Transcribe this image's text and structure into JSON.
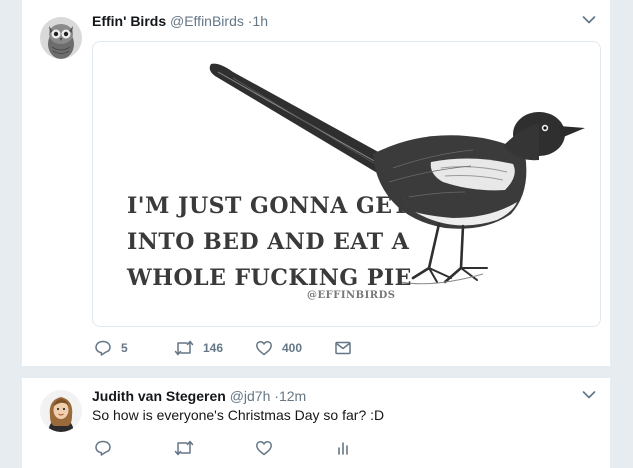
{
  "tweets": [
    {
      "name": "Effin' Birds",
      "handle": "@EffinBirds",
      "time": "·1h",
      "image": {
        "quote_lines": [
          "I'M JUST GONNA GET",
          "INTO BED AND EAT A",
          "WHOLE FUCKING PIE"
        ],
        "watermark": "@EFFINBIRDS"
      },
      "actions": {
        "replies": "5",
        "retweets": "146",
        "likes": "400"
      }
    },
    {
      "name": "Judith van Stegeren",
      "handle": "@jd7h",
      "time": "·12m",
      "text": "So how is everyone's Christmas Day so far? :D"
    }
  ],
  "colors": {
    "background": "#e6ecf0",
    "card": "#ffffff",
    "name": "#14171a",
    "secondary": "#657786",
    "border": "#e1e8ed"
  },
  "icons": [
    "owl-avatar",
    "chevron-down-icon",
    "reply-icon",
    "retweet-icon",
    "like-icon",
    "message-icon",
    "analytics-icon"
  ]
}
